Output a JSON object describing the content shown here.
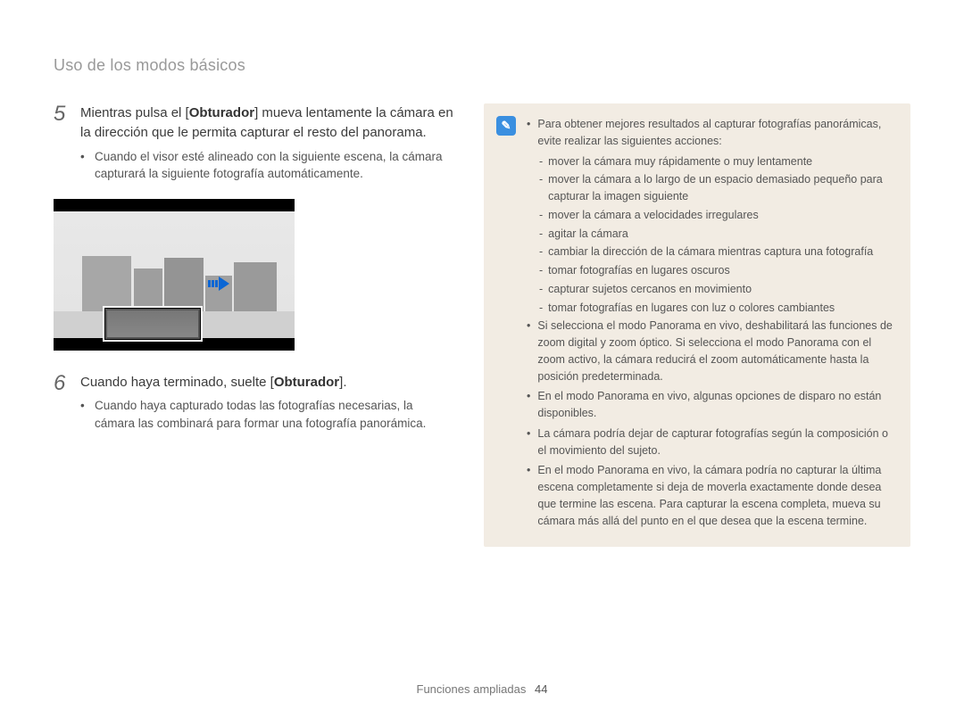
{
  "breadcrumb": "Uso de los modos básicos",
  "steps": {
    "s5": {
      "num": "5",
      "title_pre": "Mientras pulsa el [",
      "title_bold": "Obturador",
      "title_post": "] mueva lentamente la cámara en la dirección que le permita capturar el resto del panorama.",
      "sub": "Cuando el visor esté alineado con la siguiente escena, la cámara capturará la siguiente fotografía automáticamente."
    },
    "s6": {
      "num": "6",
      "title_pre": "Cuando haya terminado, suelte [",
      "title_bold": "Obturador",
      "title_post": "].",
      "sub": "Cuando haya capturado todas las fotografías necesarias, la cámara las combinará para formar una fotografía panorámica."
    }
  },
  "tips": {
    "icon_glyph": "✎",
    "intro": "Para obtener mejores resultados al capturar fotografías panorámicas, evite realizar las siguientes acciones:",
    "dashes": [
      "mover la cámara muy rápidamente o muy lentamente",
      "mover la cámara a lo largo de un espacio demasiado pequeño para capturar la imagen siguiente",
      "mover la cámara a velocidades irregulares",
      "agitar la cámara",
      "cambiar la dirección de la cámara mientras captura una fotografía",
      "tomar fotografías en lugares oscuros",
      "capturar sujetos cercanos en movimiento",
      "tomar fotografías en lugares con luz o colores cambiantes"
    ],
    "bullets": [
      "Si selecciona el modo Panorama en vivo, deshabilitará las funciones de zoom digital y zoom óptico. Si selecciona el modo Panorama con el zoom activo, la cámara reducirá el zoom automáticamente hasta la posición predeterminada.",
      "En el modo Panorama en vivo, algunas opciones de disparo no están disponibles.",
      "La cámara podría dejar de capturar fotografías según la composición o el movimiento del sujeto.",
      "En el modo Panorama en vivo, la cámara podría no capturar la última escena completamente si deja de moverla exactamente donde desea que termine las escena. Para capturar la escena completa, mueva su cámara más allá del punto en el que desea que la escena termine."
    ]
  },
  "footer": {
    "section": "Funciones ampliadas",
    "page": "44"
  }
}
